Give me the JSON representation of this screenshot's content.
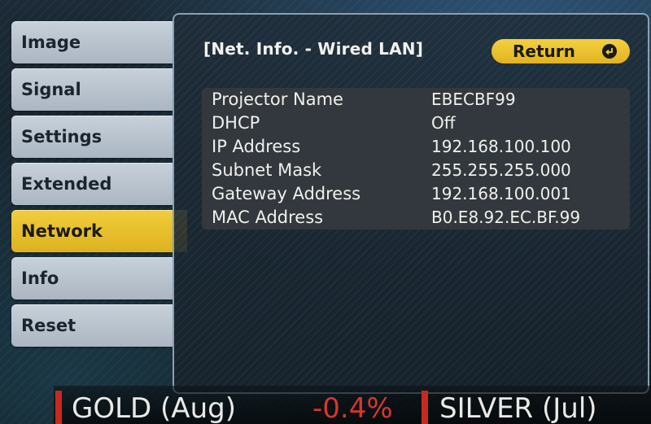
{
  "menu": {
    "items": [
      {
        "label": "Image",
        "active": false
      },
      {
        "label": "Signal",
        "active": false
      },
      {
        "label": "Settings",
        "active": false
      },
      {
        "label": "Extended",
        "active": false
      },
      {
        "label": "Network",
        "active": true
      },
      {
        "label": "Info",
        "active": false
      },
      {
        "label": "Reset",
        "active": false
      }
    ]
  },
  "panel": {
    "title": "[Net. Info. - Wired LAN]",
    "return_label": "Return",
    "return_icon": "enter-icon",
    "rows": [
      {
        "label": "Projector Name",
        "value": "EBECBF99"
      },
      {
        "label": "DHCP",
        "value": "Off"
      },
      {
        "label": "IP Address",
        "value": "192.168.100.100"
      },
      {
        "label": "Subnet Mask",
        "value": "255.255.255.000"
      },
      {
        "label": "Gateway Address",
        "value": "192.168.100.001"
      },
      {
        "label": "MAC Address",
        "value": "B0.E8.92.EC.BF.99"
      }
    ]
  },
  "ticker": {
    "item1": "GOLD (Aug)",
    "change1": "-0.4%",
    "item2": "SILVER (Jul)"
  },
  "colors": {
    "accent_yellow": "#e8bd2a",
    "menu_gray": "#b8c2cc",
    "negative_red": "#d8362c"
  }
}
